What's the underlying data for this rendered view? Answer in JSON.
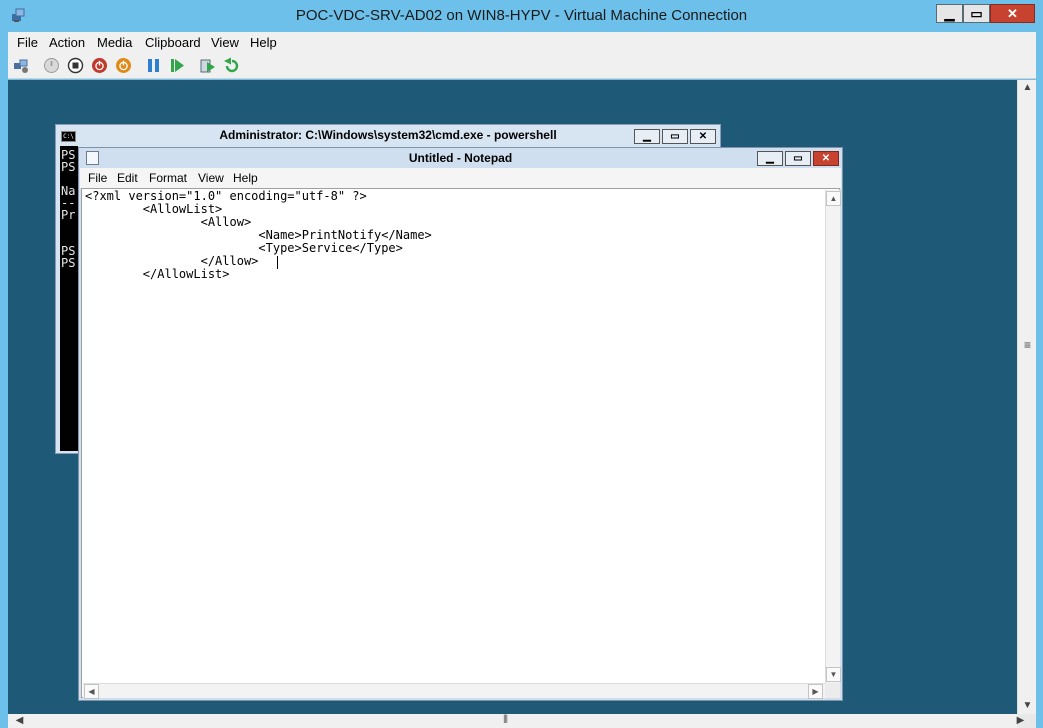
{
  "vm": {
    "title": "POC-VDC-SRV-AD02 on WIN8-HYPV - Virtual Machine Connection",
    "menu": [
      "File",
      "Action",
      "Media",
      "Clipboard",
      "View",
      "Help"
    ],
    "toolbar": [
      {
        "name": "ctrl-alt-del-icon",
        "color": "#4a6fa0"
      },
      {
        "name": "start-icon",
        "color": "#b0b0b0"
      },
      {
        "name": "turn-off-icon",
        "color": "#555555"
      },
      {
        "name": "shut-down-icon",
        "color": "#c0392b"
      },
      {
        "name": "save-icon",
        "color": "#e08a1a"
      },
      {
        "name": "pause-icon",
        "color": "#2f7fd1"
      },
      {
        "name": "reset-icon",
        "color": "#31a64a"
      },
      {
        "name": "snapshot-icon",
        "color": "#31a64a"
      },
      {
        "name": "revert-icon",
        "color": "#31a64a"
      }
    ],
    "captions": {
      "minimize": "▁",
      "maximize": "▭",
      "close": "✕"
    }
  },
  "powershell": {
    "title": "Administrator: C:\\Windows\\system32\\cmd.exe - powershell",
    "icon_text": "C:\\",
    "lines": [
      "PS",
      "PS",
      "",
      "Na",
      "--",
      "Pr",
      "",
      "",
      "PS",
      "PS"
    ]
  },
  "notepad": {
    "title": "Untitled - Notepad",
    "menu": [
      "File",
      "Edit",
      "Format",
      "View",
      "Help"
    ],
    "content": "<?xml version=\"1.0\" encoding=\"utf-8\" ?>\n        <AllowList>\n                <Allow>\n                        <Name>PrintNotify</Name>\n                        <Type>Service</Type>\n                </Allow>\n        </AllowList>"
  }
}
